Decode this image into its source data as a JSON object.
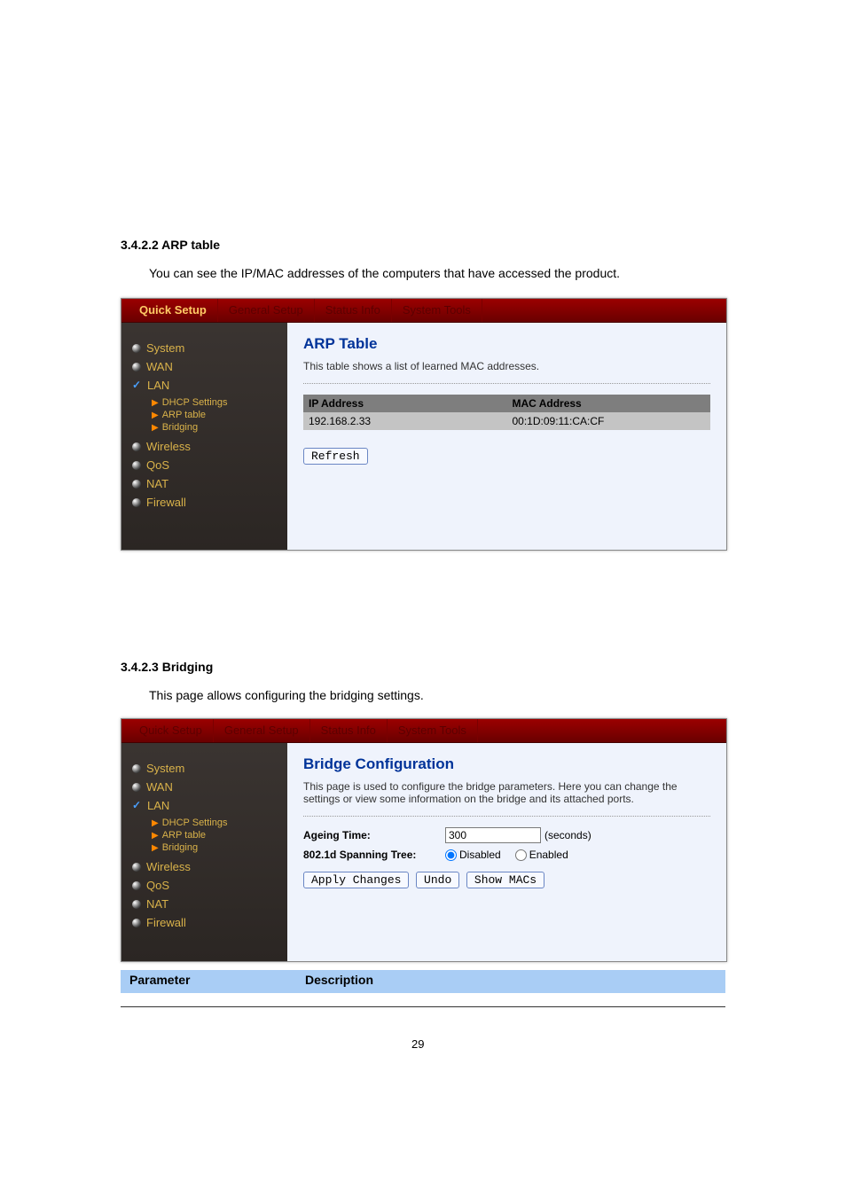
{
  "doc": {
    "line1": "3.4.2.2 ARP table",
    "line2": "You can see the IP/MAC addresses of the computers that have accessed the product.",
    "line3": "3.4.2.3 Bridging",
    "line4": "This page allows configuring the bridging settings.",
    "footer_param": "Parameter",
    "footer_desc": "Description",
    "page_no": "29"
  },
  "topbar": {
    "tabs": [
      "Quick Setup",
      "General Setup",
      "Status Info",
      "System Tools"
    ]
  },
  "sidebar": {
    "items": [
      {
        "label": "System",
        "type": "dot"
      },
      {
        "label": "WAN",
        "type": "dot"
      },
      {
        "label": "LAN",
        "type": "check",
        "subs": [
          "DHCP Settings",
          "ARP table",
          "Bridging"
        ]
      },
      {
        "label": "Wireless",
        "type": "dot"
      },
      {
        "label": "QoS",
        "type": "dot"
      },
      {
        "label": "NAT",
        "type": "dot"
      },
      {
        "label": "Firewall",
        "type": "dot"
      }
    ]
  },
  "arp": {
    "title": "ARP Table",
    "desc": "This table shows a list of learned MAC addresses.",
    "cols": [
      "IP Address",
      "MAC Address"
    ],
    "rows": [
      {
        "ip": "192.168.2.33",
        "mac": "00:1D:09:11:CA:CF"
      }
    ],
    "refresh": "Refresh"
  },
  "bridge": {
    "title": "Bridge Configuration",
    "desc": "This page is used to configure the bridge parameters. Here you can change the settings or view some information on the bridge and its attached ports.",
    "ageing_label": "Ageing Time:",
    "ageing_value": "300",
    "ageing_unit": "(seconds)",
    "spanning_label": "802.1d Spanning Tree:",
    "disabled": "Disabled",
    "enabled": "Enabled",
    "apply": "Apply Changes",
    "undo": "Undo",
    "show_macs": "Show MACs"
  }
}
